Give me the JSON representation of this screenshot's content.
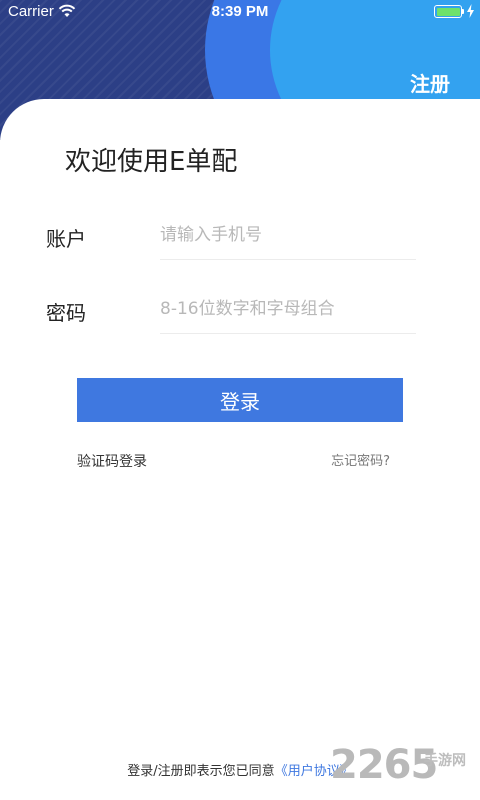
{
  "status_bar": {
    "carrier": "Carrier",
    "time": "8:39 PM",
    "icons": [
      "wifi-icon",
      "battery-icon",
      "charging-icon"
    ]
  },
  "header": {
    "register_label": "注册"
  },
  "welcome_title": "欢迎使用E单配",
  "form": {
    "account_label": "账户",
    "account_placeholder": "请输入手机号",
    "password_label": "密码",
    "password_placeholder": "8-16位数字和字母组合",
    "login_label": "登录"
  },
  "links": {
    "sms_login": "验证码登录",
    "forgot_password": "忘记密码?"
  },
  "agreement": {
    "prefix": "登录/注册即表示您已同意",
    "link": "《用户协议》"
  },
  "watermark": {
    "number": "2265",
    "text": "手游网"
  },
  "colors": {
    "header_dark": "#2c3f86",
    "header_blue": "#3a77e6",
    "header_light": "#33a2f0",
    "primary_button": "#3f78e0",
    "battery_fill": "#6ee26b"
  }
}
